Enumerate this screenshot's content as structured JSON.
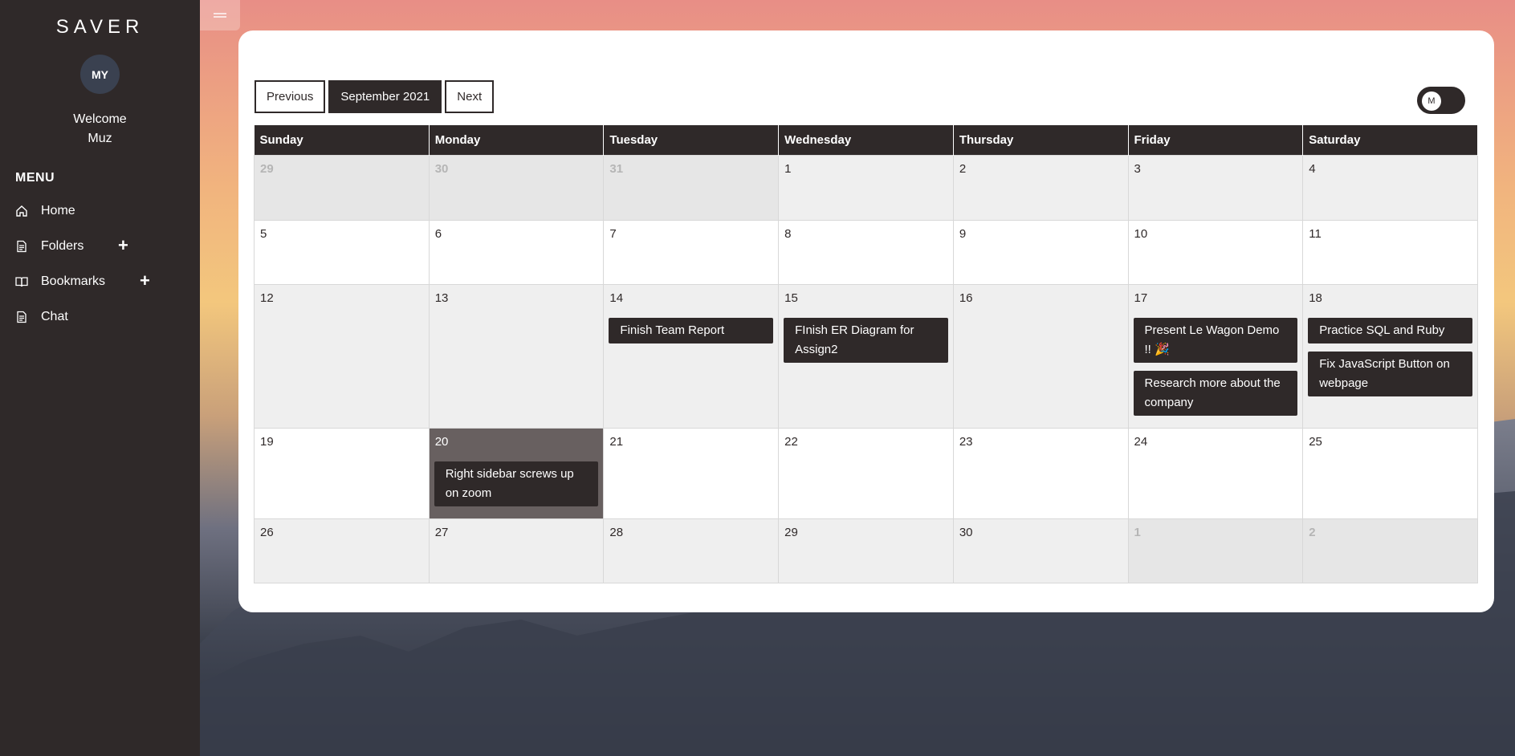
{
  "app": {
    "brand": "SAVER"
  },
  "user": {
    "initials": "MY",
    "welcome": "Welcome",
    "name": "Muz"
  },
  "menu": {
    "title": "MENU",
    "items": [
      {
        "label": "Home",
        "icon": "home-icon"
      },
      {
        "label": "Folders",
        "icon": "document-icon",
        "action": "+"
      },
      {
        "label": "Bookmarks",
        "icon": "book-icon",
        "action": "+"
      },
      {
        "label": "Chat",
        "icon": "document-icon"
      }
    ]
  },
  "calendar": {
    "prev_label": "Previous",
    "month_label": "September 2021",
    "next_label": "Next",
    "toggle_label": "M",
    "weekdays": [
      "Sunday",
      "Monday",
      "Tuesday",
      "Wednesday",
      "Thursday",
      "Friday",
      "Saturday"
    ],
    "weeks": [
      [
        {
          "day": "29",
          "other": true
        },
        {
          "day": "30",
          "other": true
        },
        {
          "day": "31",
          "other": true
        },
        {
          "day": "1"
        },
        {
          "day": "2"
        },
        {
          "day": "3"
        },
        {
          "day": "4"
        }
      ],
      [
        {
          "day": "5"
        },
        {
          "day": "6"
        },
        {
          "day": "7"
        },
        {
          "day": "8"
        },
        {
          "day": "9"
        },
        {
          "day": "10"
        },
        {
          "day": "11"
        }
      ],
      [
        {
          "day": "12"
        },
        {
          "day": "13"
        },
        {
          "day": "14",
          "events": [
            "Finish Team Report"
          ]
        },
        {
          "day": "15",
          "events": [
            "FInish ER Diagram for Assign2"
          ]
        },
        {
          "day": "16"
        },
        {
          "day": "17",
          "events": [
            "Present Le Wagon Demo !! 🎉",
            "Research more about the company"
          ]
        },
        {
          "day": "18",
          "events": [
            "Practice SQL and Ruby",
            "Fix JavaScript Button on webpage"
          ]
        }
      ],
      [
        {
          "day": "19"
        },
        {
          "day": "20",
          "today": true,
          "events": [
            "Right sidebar screws up on zoom"
          ]
        },
        {
          "day": "21"
        },
        {
          "day": "22"
        },
        {
          "day": "23"
        },
        {
          "day": "24"
        },
        {
          "day": "25"
        }
      ],
      [
        {
          "day": "26"
        },
        {
          "day": "27"
        },
        {
          "day": "28"
        },
        {
          "day": "29"
        },
        {
          "day": "30"
        },
        {
          "day": "1",
          "other": true
        },
        {
          "day": "2",
          "other": true
        }
      ]
    ]
  }
}
